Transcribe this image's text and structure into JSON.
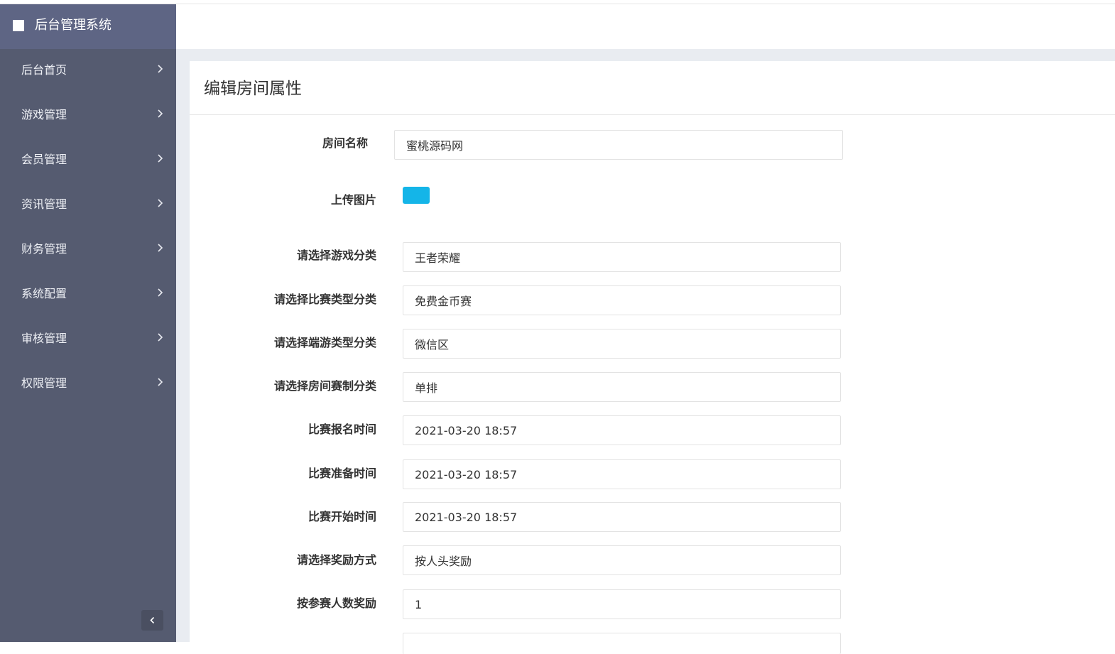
{
  "app": {
    "title": "后台管理系统"
  },
  "sidebar": {
    "items": [
      {
        "label": "后台首页"
      },
      {
        "label": "游戏管理"
      },
      {
        "label": "会员管理"
      },
      {
        "label": "资讯管理"
      },
      {
        "label": "财务管理"
      },
      {
        "label": "系统配置"
      },
      {
        "label": "审核管理"
      },
      {
        "label": "权限管理"
      }
    ]
  },
  "page": {
    "title": "编辑房间属性"
  },
  "form": {
    "room_name": {
      "label": "房间名称",
      "value": "蜜桃源码网"
    },
    "upload": {
      "label": "上传图片"
    },
    "game_category": {
      "label": "请选择游戏分类",
      "value": "王者荣耀"
    },
    "match_type": {
      "label": "请选择比赛类型分类",
      "value": "免费金币赛"
    },
    "client_type": {
      "label": "请选择端游类型分类",
      "value": "微信区"
    },
    "room_format": {
      "label": "请选择房间赛制分类",
      "value": "单排"
    },
    "signup_time": {
      "label": "比赛报名时间",
      "value": "2021-03-20 18:57"
    },
    "prepare_time": {
      "label": "比赛准备时间",
      "value": "2021-03-20 18:57"
    },
    "start_time": {
      "label": "比赛开始时间",
      "value": "2021-03-20 18:57"
    },
    "reward_method": {
      "label": "请选择奖励方式",
      "value": "按人头奖励"
    },
    "reward_by_count": {
      "label": "按参赛人数奖励",
      "value": "1"
    }
  },
  "colors": {
    "sidebar_bg": "#555b70",
    "brand_bg": "#5e6584",
    "accent": "#14b5e8",
    "content_bg": "#e9ecf1"
  }
}
